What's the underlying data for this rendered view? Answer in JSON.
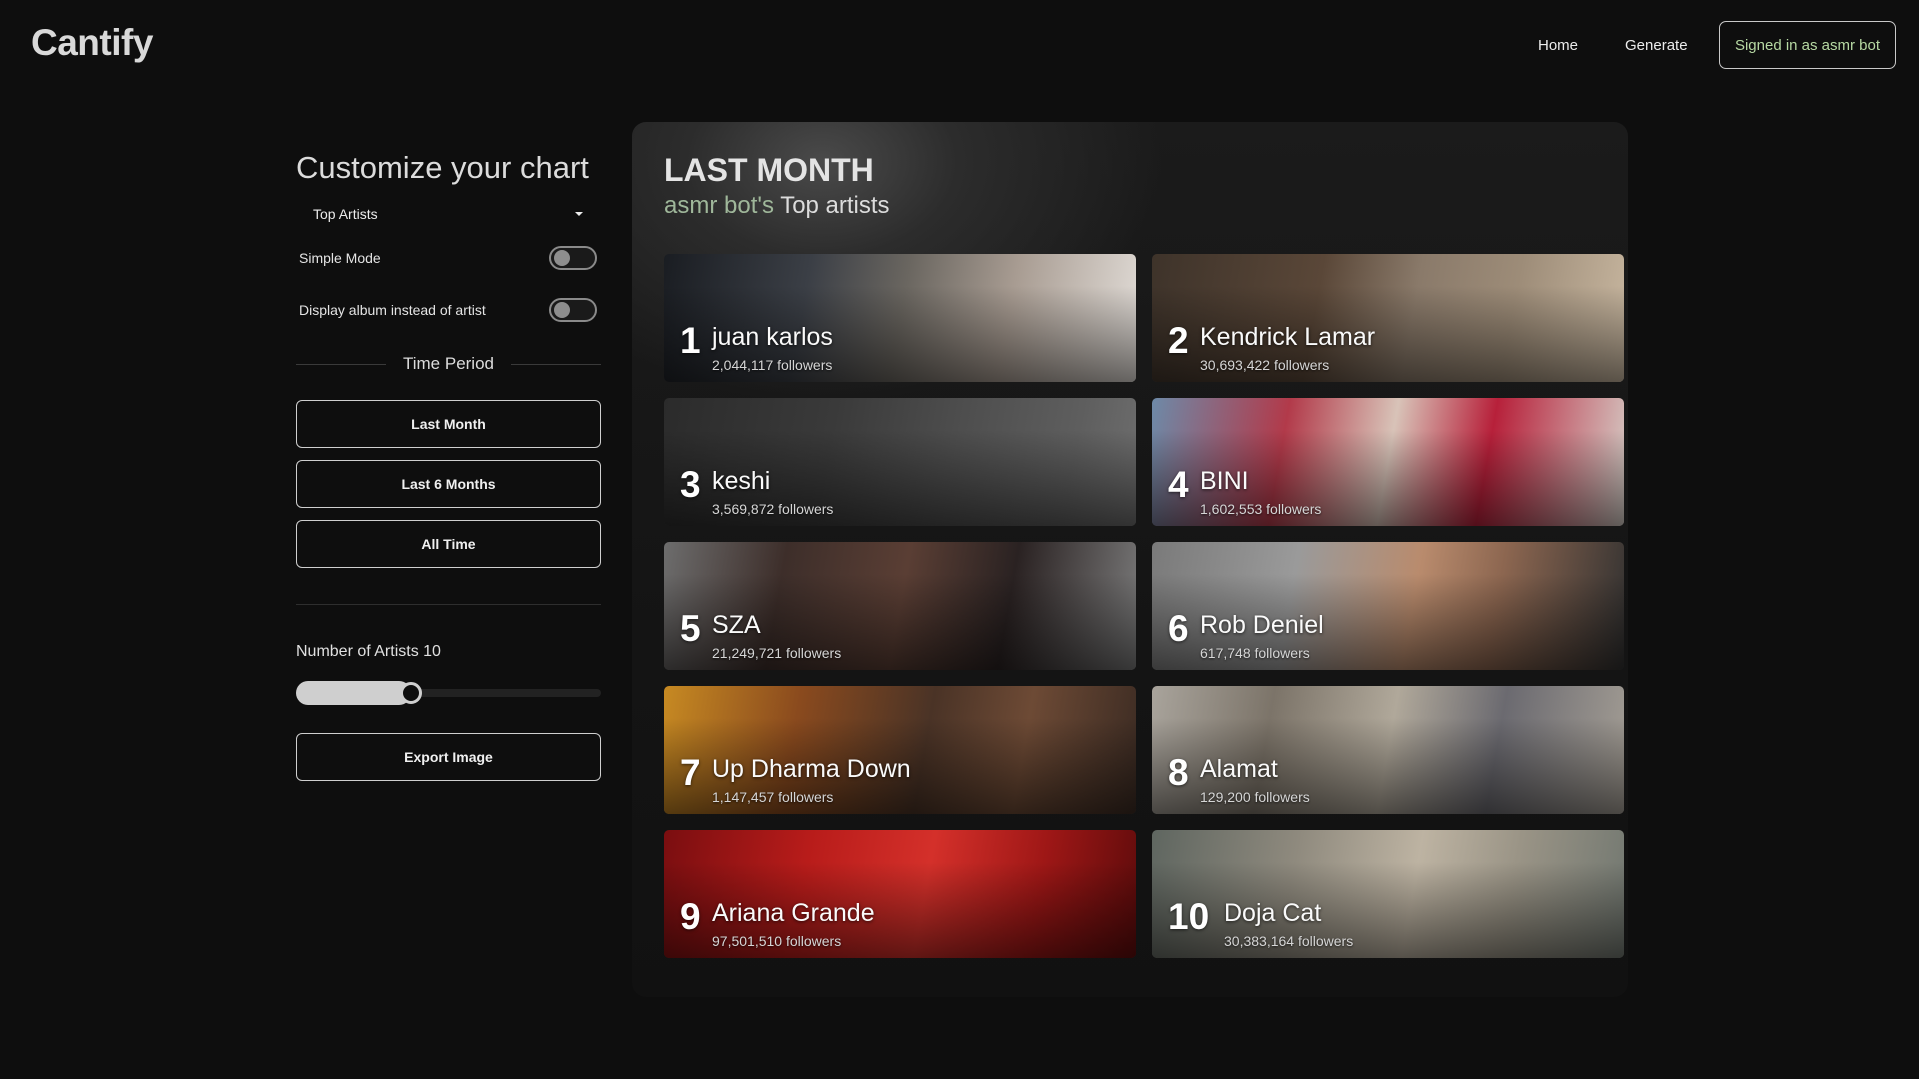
{
  "header": {
    "logo": "Cantify",
    "nav": {
      "home": "Home",
      "generate": "Generate"
    },
    "signin_label": "Signed in as asmr bot",
    "signin_color": "#b7d9a3"
  },
  "sidebar": {
    "title": "Customize your chart",
    "chart_type": "Top Artists",
    "toggles": {
      "simple_mode": {
        "label": "Simple Mode",
        "on": false
      },
      "album_mode": {
        "label": "Display album instead of artist",
        "on": false
      }
    },
    "time_period_label": "Time Period",
    "periods": [
      "Last Month",
      "Last 6 Months",
      "All Time"
    ],
    "count_label": "Number of Artists",
    "count_value": "10",
    "slider_fraction": 0.21,
    "export_label": "Export Image"
  },
  "panel": {
    "title": "LAST MONTH",
    "user": "asmr bot's",
    "subtitle": "Top artists",
    "artists": [
      {
        "rank": "1",
        "name": "juan karlos",
        "followers": "2,044,117 followers",
        "bg": "linear-gradient(100deg,#1a1d22 0%,#3b3f46 30%,#6a6660 50%,#a89c92 72%,#e2ddd8 100%)"
      },
      {
        "rank": "2",
        "name": "Kendrick Lamar",
        "followers": "30,693,422 followers",
        "bg": "linear-gradient(100deg,#3e332a 0%,#5a4738 35%,#8a7a6a 55%,#9d8c78 75%,#c8b7a0 100%)"
      },
      {
        "rank": "3",
        "name": "keshi",
        "followers": "3,569,872 followers",
        "bg": "linear-gradient(100deg,#2b2b2b 0%,#3a3a3a 35%,#4d4d4d 60%,#5e5e5e 85%,#6e6e6e 100%)"
      },
      {
        "rank": "4",
        "name": "BINI",
        "followers": "1,602,553 followers",
        "bg": "linear-gradient(100deg,#6d8aa8 0%,#b23a4a 28%,#d8c3b8 50%,#b7203a 70%,#d6cfc8 100%)"
      },
      {
        "rank": "5",
        "name": "SZA",
        "followers": "21,249,721 followers",
        "bg": "linear-gradient(100deg,#6d6d6d 0%,#3d2e2a 25%,#5a3e34 50%,#2a2222 72%,#7b7b7b 100%)"
      },
      {
        "rank": "6",
        "name": "Rob Deniel",
        "followers": "617,748 followers",
        "bg": "linear-gradient(100deg,#7a7a7a 0%,#9a9a9a 30%,#b98b6d 55%,#8c6650 72%,#303030 100%)"
      },
      {
        "rank": "7",
        "name": "Up Dharma Down",
        "followers": "1,147,457 followers",
        "bg": "linear-gradient(100deg,#c78a22 0%,#8a4a1e 28%,#4a3326 55%,#6d4a35 75%,#3a2a22 100%)"
      },
      {
        "rank": "8",
        "name": "Alamat",
        "followers": "129,200 followers",
        "bg": "linear-gradient(100deg,#a9a49c 0%,#7c7469 25%,#b0a89a 50%,#6b6a70 72%,#a49e95 100%)"
      },
      {
        "rank": "9",
        "name": "Ariana Grande",
        "followers": "97,501,510 followers",
        "bg": "linear-gradient(100deg,#7a0e10 0%,#b81c1a 30%,#d4302a 55%,#9e1716 78%,#5c0b0b 100%)"
      },
      {
        "rank": "10",
        "name": "Doja Cat",
        "followers": "30,383,164 followers",
        "bg": "linear-gradient(100deg,#5f6660 0%,#8f8a7e 30%,#bdb3a2 55%,#9a9486 75%,#717770 100%)"
      }
    ]
  }
}
